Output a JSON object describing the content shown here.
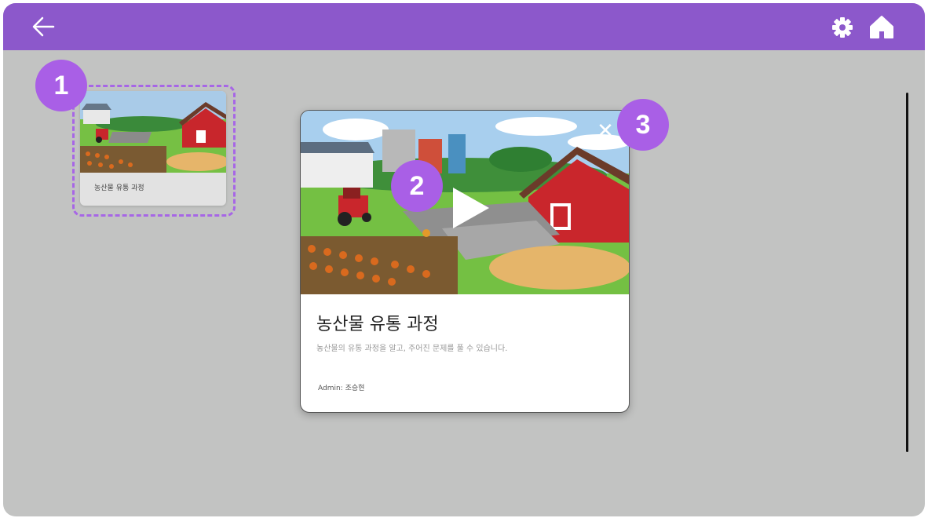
{
  "colors": {
    "topbar": "#8c58cb",
    "background": "#c2c3c2",
    "marker": "#a95fe6",
    "dashed_outline": "#a766e6"
  },
  "topbar": {
    "back_icon": "arrow-left-icon",
    "settings_icon": "gear-icon",
    "home_icon": "home-icon"
  },
  "thumbnail": {
    "label": "농산물 유통 과정"
  },
  "markers": [
    "1",
    "2",
    "3"
  ],
  "modal": {
    "title": "농산물 유통 과정",
    "description": "농산물의 유통 과정을 알고, 주어진 문제를 풀 수 있습니다.",
    "admin": "Admin: 조승현",
    "close_glyph": "✕",
    "play_icon": "play-icon"
  }
}
